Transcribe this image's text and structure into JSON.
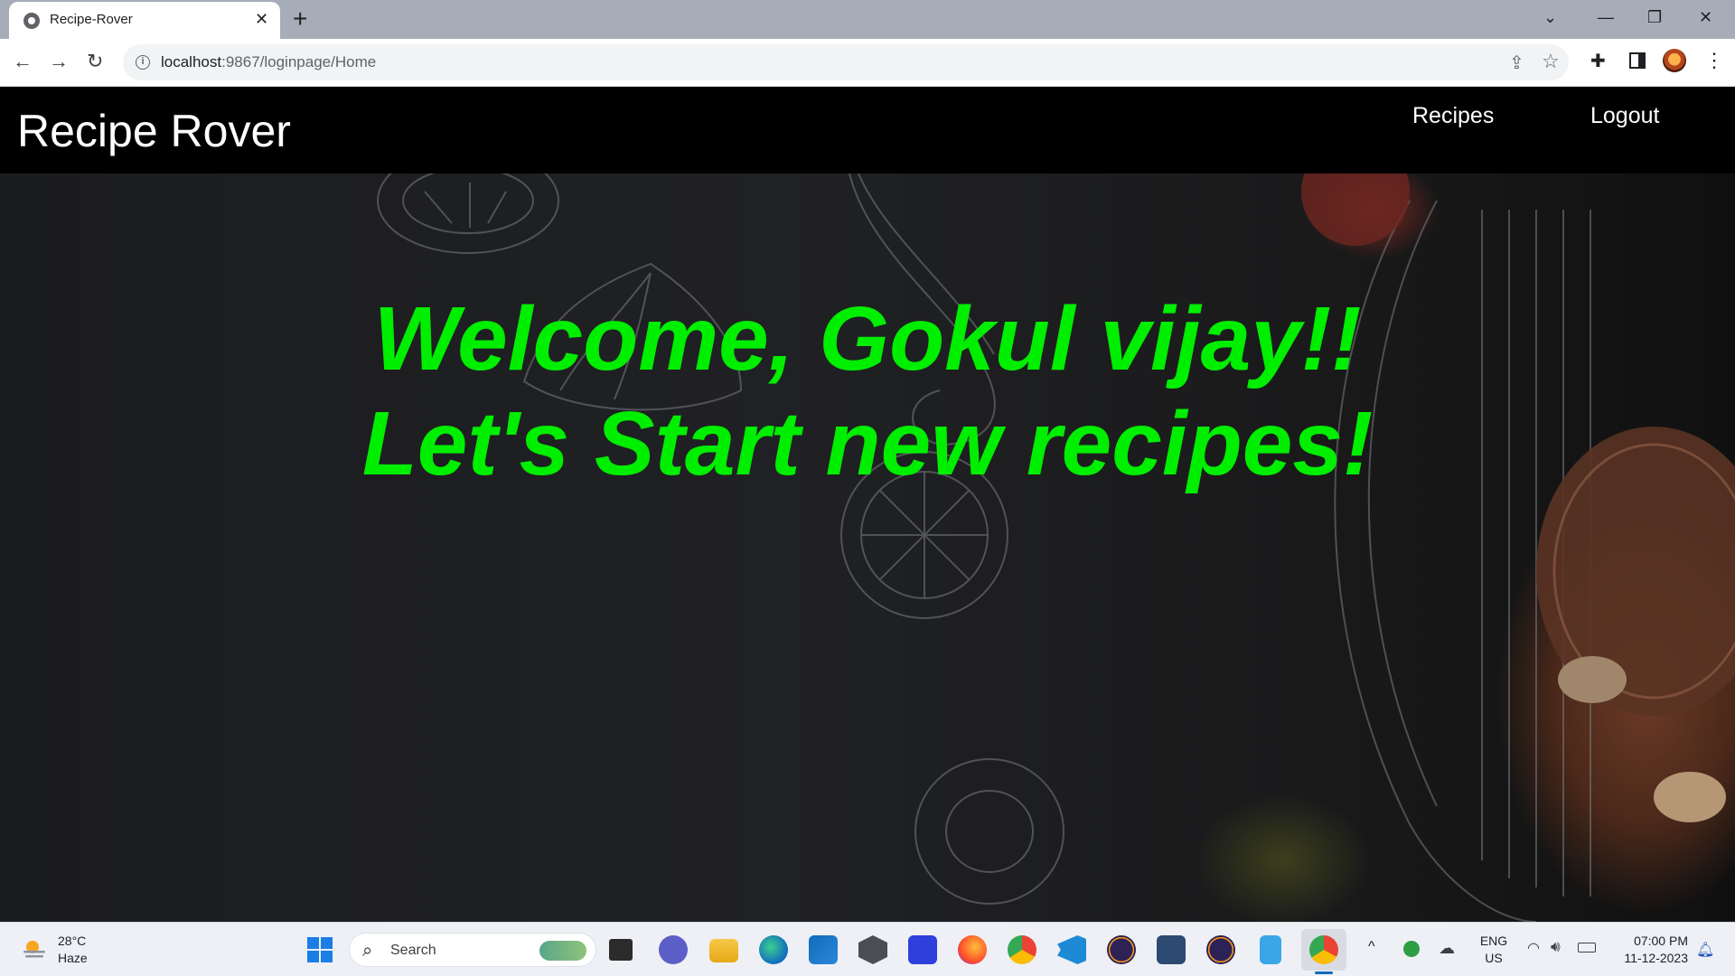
{
  "browser": {
    "tab_title": "Recipe-Rover",
    "url_host": "localhost",
    "url_path": ":9867/loginpage/Home"
  },
  "navbar": {
    "brand": "Recipe Rover",
    "links": [
      "Recipes",
      "Logout"
    ]
  },
  "hero": {
    "line1": "Welcome, Gokul vijay!!",
    "line2": "Let's Start new recipes!",
    "text_color": "#00ee00"
  },
  "taskbar": {
    "weather_temp": "28°C",
    "weather_desc": "Haze",
    "search_placeholder": "Search",
    "language": "ENG",
    "region": "US",
    "time": "07:00 PM",
    "date": "11-12-2023"
  }
}
